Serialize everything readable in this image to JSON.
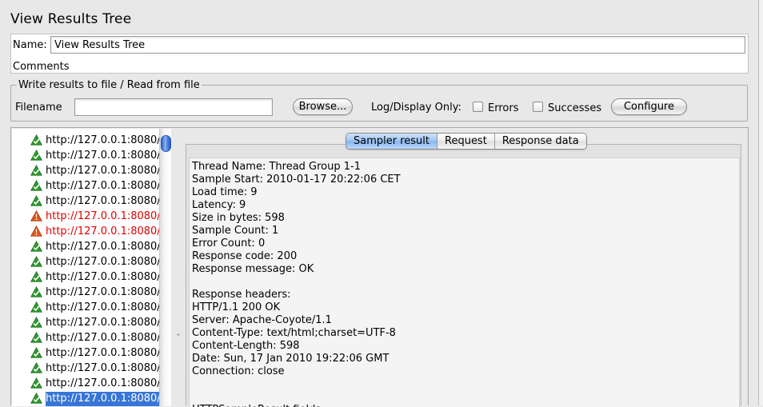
{
  "window": {
    "title": "View Results Tree"
  },
  "form": {
    "name_label": "Name:",
    "name_value": "View Results Tree",
    "comments_label": "Comments:"
  },
  "file_panel": {
    "legend": "Write results to file / Read from file",
    "filename_label": "Filename",
    "filename_value": "",
    "browse_label": "Browse...",
    "log_display_label": "Log/Display Only:",
    "errors_label": "Errors",
    "errors_checked": false,
    "successes_label": "Successes",
    "successes_checked": false,
    "configure_label": "Configure"
  },
  "tree": {
    "items": [
      {
        "label": "http://127.0.0.1:8080/",
        "status": "success"
      },
      {
        "label": "http://127.0.0.1:8080/",
        "status": "success"
      },
      {
        "label": "http://127.0.0.1:8080/",
        "status": "success"
      },
      {
        "label": "http://127.0.0.1:8080/",
        "status": "success"
      },
      {
        "label": "http://127.0.0.1:8080/",
        "status": "success"
      },
      {
        "label": "http://127.0.0.1:8080/",
        "status": "error"
      },
      {
        "label": "http://127.0.0.1:8080/",
        "status": "error"
      },
      {
        "label": "http://127.0.0.1:8080/",
        "status": "success"
      },
      {
        "label": "http://127.0.0.1:8080/",
        "status": "success"
      },
      {
        "label": "http://127.0.0.1:8080/",
        "status": "success"
      },
      {
        "label": "http://127.0.0.1:8080/",
        "status": "success"
      },
      {
        "label": "http://127.0.0.1:8080/",
        "status": "success"
      },
      {
        "label": "http://127.0.0.1:8080/",
        "status": "success"
      },
      {
        "label": "http://127.0.0.1:8080/",
        "status": "success"
      },
      {
        "label": "http://127.0.0.1:8080/",
        "status": "success"
      },
      {
        "label": "http://127.0.0.1:8080/",
        "status": "success"
      },
      {
        "label": "http://127.0.0.1:8080/",
        "status": "success"
      },
      {
        "label": "http://127.0.0.1:8080/",
        "status": "success",
        "selected": true
      }
    ]
  },
  "tabs": {
    "sampler_result": "Sampler result",
    "request": "Request",
    "response_data": "Response data",
    "active": "sampler_result"
  },
  "sampler_result": {
    "lines": [
      "Thread Name: Thread Group 1-1",
      "Sample Start: 2010-01-17 20:22:06 CET",
      "Load time: 9",
      "Latency: 9",
      "Size in bytes: 598",
      "Sample Count: 1",
      "Error Count: 0",
      "Response code: 200",
      "Response message: OK",
      "",
      "Response headers:",
      "HTTP/1.1 200 OK",
      "Server: Apache-Coyote/1.1",
      "Content-Type: text/html;charset=UTF-8",
      "Content-Length: 598",
      "Date: Sun, 17 Jan 2010 19:22:06 GMT",
      "Connection: close",
      "",
      "",
      "HTTPSampleResult fields:"
    ]
  },
  "colors": {
    "error_text": "#e00000",
    "selection": "#3875d7",
    "success_icon": "#2f9a2f",
    "error_icon": "#e0591a"
  }
}
